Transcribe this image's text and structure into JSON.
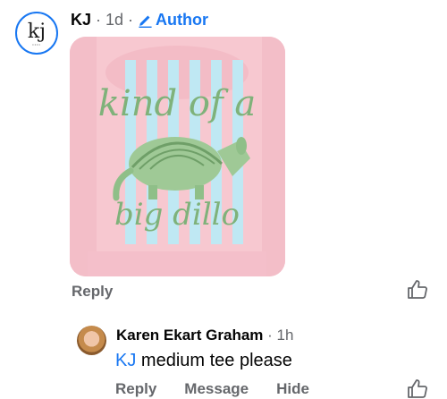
{
  "comment": {
    "avatar_text": "kj",
    "author": "KJ",
    "time": "1d",
    "author_badge": "Author",
    "image_text_line1": "kind of a",
    "image_text_line2": "big dillo",
    "reply_label": "Reply"
  },
  "reply": {
    "author": "Karen Ekart Graham",
    "time": "1h",
    "mention": "KJ",
    "text": "medium tee please",
    "actions": {
      "reply": "Reply",
      "message": "Message",
      "hide": "Hide"
    }
  },
  "colors": {
    "accent": "#1877f2",
    "secondary_text": "#65676b",
    "sweatshirt": "#f7c8d0",
    "stripe": "#bfe8f3",
    "armadillo": "#8fbf88"
  }
}
